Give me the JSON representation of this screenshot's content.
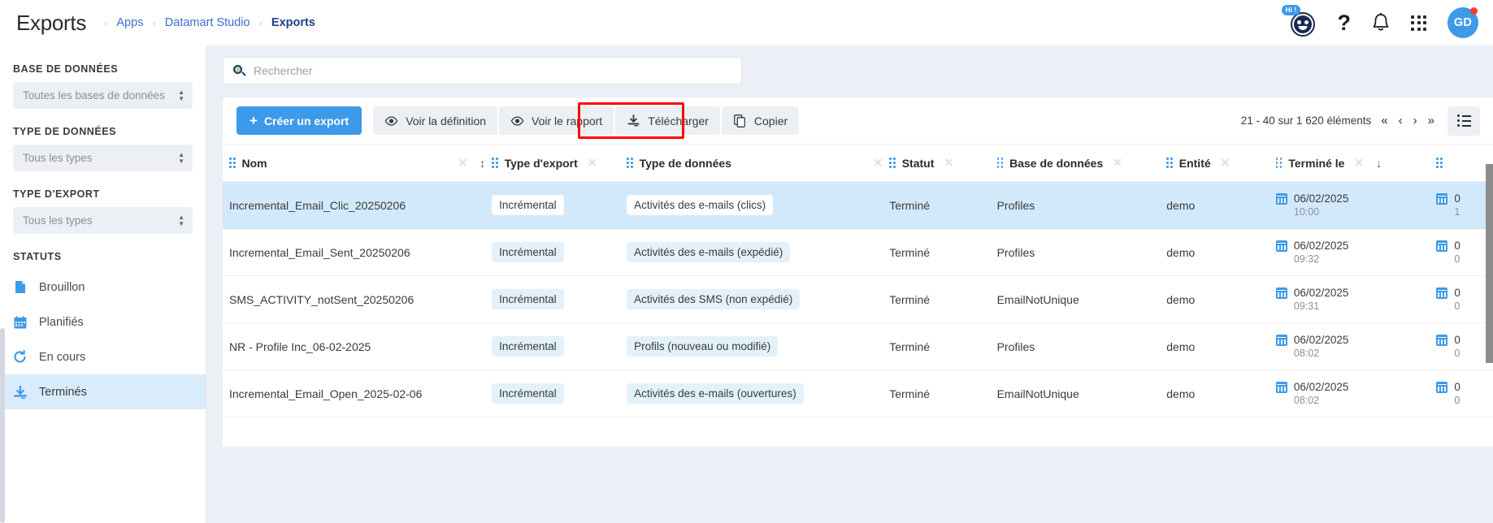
{
  "header": {
    "title": "Exports",
    "breadcrumb": [
      {
        "label": "Apps"
      },
      {
        "label": "Datamart Studio"
      },
      {
        "label": "Exports"
      }
    ],
    "bot_badge": "Hi !",
    "help_glyph": "?",
    "avatar_initials": "GD"
  },
  "sidebar": {
    "filters": [
      {
        "label": "BASE DE DONNÉES",
        "value": "Toutes les bases de données"
      },
      {
        "label": "TYPE DE DONNÉES",
        "value": "Tous les types"
      },
      {
        "label": "TYPE D'EXPORT",
        "value": "Tous les types"
      }
    ],
    "statuses_label": "STATUTS",
    "statuses": [
      {
        "label": "Brouillon",
        "icon": "document-icon",
        "selected": false
      },
      {
        "label": "Planifiés",
        "icon": "calendar-icon",
        "selected": false
      },
      {
        "label": "En cours",
        "icon": "refresh-icon",
        "selected": false
      },
      {
        "label": "Terminés",
        "icon": "download-icon",
        "selected": true
      }
    ]
  },
  "search": {
    "placeholder": "Rechercher",
    "value": ""
  },
  "toolbar": {
    "create_label": "Créer un export",
    "create_plus": "+",
    "view_definition_label": "Voir la définition",
    "view_report_label": "Voir le rapport",
    "download_label": "Télécharger",
    "copy_label": "Copier",
    "highlighted_button": "download-button"
  },
  "pagination": {
    "range_text": "21 - 40 sur 1 620 éléments",
    "first": "«",
    "prev": "‹",
    "next": "›",
    "last": "»"
  },
  "table": {
    "columns": [
      {
        "label": "Nom",
        "sort": "↕"
      },
      {
        "label": "Type d'export",
        "sort": ""
      },
      {
        "label": "Type de données",
        "sort": ""
      },
      {
        "label": "Statut",
        "sort": ""
      },
      {
        "label": "Base de données",
        "sort": ""
      },
      {
        "label": "Entité",
        "sort": ""
      },
      {
        "label": "Terminé le",
        "sort": "↓"
      },
      {
        "label": "",
        "sort": ""
      }
    ],
    "rows": [
      {
        "name": "Incremental_Email_Clic_20250206",
        "export_type": "Incrémental",
        "data_type": "Activités des e-mails (clics)",
        "status": "Terminé",
        "database": "Profiles",
        "entity": "demo",
        "finished_date": "06/02/2025",
        "finished_time": "10:00",
        "extra_date": "0",
        "extra_time": "1",
        "selected": true
      },
      {
        "name": "Incremental_Email_Sent_20250206",
        "export_type": "Incrémental",
        "data_type": "Activités des e-mails (expédié)",
        "status": "Terminé",
        "database": "Profiles",
        "entity": "demo",
        "finished_date": "06/02/2025",
        "finished_time": "09:32",
        "extra_date": "0",
        "extra_time": "0",
        "selected": false
      },
      {
        "name": "SMS_ACTIVITY_notSent_20250206",
        "export_type": "Incrémental",
        "data_type": "Activités des SMS (non expédié)",
        "status": "Terminé",
        "database": "EmailNotUnique",
        "entity": "demo",
        "finished_date": "06/02/2025",
        "finished_time": "09:31",
        "extra_date": "0",
        "extra_time": "0",
        "selected": false
      },
      {
        "name": "NR - Profile Inc_06-02-2025",
        "export_type": "Incrémental",
        "data_type": "Profils (nouveau ou modifié)",
        "status": "Terminé",
        "database": "Profiles",
        "entity": "demo",
        "finished_date": "06/02/2025",
        "finished_time": "08:02",
        "extra_date": "0",
        "extra_time": "0",
        "selected": false
      },
      {
        "name": "Incremental_Email_Open_2025-02-06",
        "export_type": "Incrémental",
        "data_type": "Activités des e-mails (ouvertures)",
        "status": "Terminé",
        "database": "EmailNotUnique",
        "entity": "demo",
        "finished_date": "06/02/2025",
        "finished_time": "08:02",
        "extra_date": "0",
        "extra_time": "0",
        "selected": false
      }
    ]
  },
  "colors": {
    "primary": "#3d9ae8",
    "selected_row": "#d2e9fb",
    "highlight": "#ff0000",
    "tag_bg": "#e3f1fb"
  }
}
